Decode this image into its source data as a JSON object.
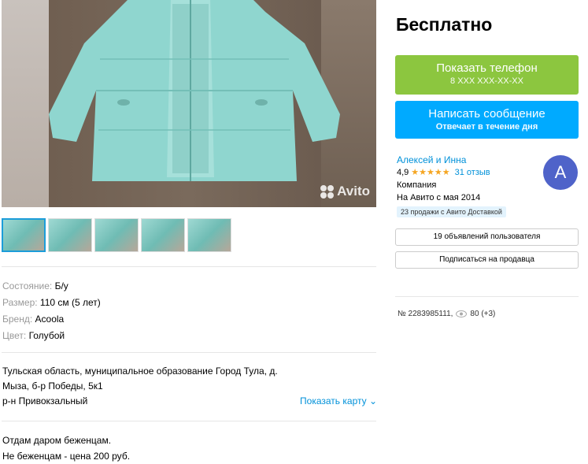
{
  "listing": {
    "watermark": "Avito",
    "price": "Бесплатно",
    "params": [
      {
        "key": "Состояние:",
        "value": "Б/у"
      },
      {
        "key": "Размер:",
        "value": "110 см (5 лет)"
      },
      {
        "key": "Бренд:",
        "value": "Acoola"
      },
      {
        "key": "Цвет:",
        "value": "Голубой"
      }
    ],
    "address": {
      "line1": "Тульская область, муниципальное образование Город Тула, д.",
      "line2": "Мыза, б-р Победы, 5к1",
      "line3": "р-н Привокзальный",
      "map_link": "Показать карту"
    },
    "description": {
      "line1": "Отдам даром беженцам.",
      "line2": "Не беженцам - цена 200 руб."
    }
  },
  "actions": {
    "phone_label": "Показать телефон",
    "phone_sub": "8 XXX XXX-XX-XX",
    "message_label": "Написать сообщение",
    "message_sub": "Отвечает в течение дня"
  },
  "seller": {
    "name": "Алексей и Инна",
    "rating": "4,9",
    "stars": "★★★★★",
    "reviews": "31 отзыв",
    "type": "Компания",
    "since": "На Авито с мая 2014",
    "badge": "23 продажи с Авито Доставкой",
    "avatar_letter": "А",
    "ads_button": "19 объявлений пользователя",
    "subscribe_button": "Подписаться на продавца"
  },
  "meta": {
    "number": "№ 2283985111,",
    "views": "80 (+3)"
  },
  "colors": {
    "green": "#8cc63f",
    "blue": "#00aaff",
    "link": "#0091d9",
    "avatar": "#4f63c9"
  }
}
